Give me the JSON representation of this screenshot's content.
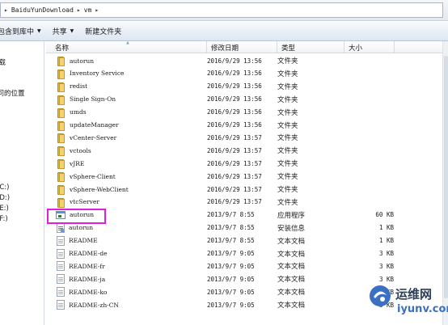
{
  "address": {
    "path": [
      "BaiduYunDownload",
      "vm"
    ],
    "separators": [
      "▸",
      "▸",
      "▸"
    ]
  },
  "toolbar": {
    "include_label": "包含到库中",
    "share_label": "共享",
    "new_folder_label": "新建文件夹"
  },
  "nav": {
    "items": [
      "下载",
      "访问的位置",
      "(C:)",
      "(D:)",
      "(E:)",
      "(F:)"
    ]
  },
  "columns": {
    "name": "名称",
    "date": "修改日期",
    "type": "类型",
    "size": "大小"
  },
  "files": [
    {
      "name": "autorun",
      "date": "2016/9/29 13:56",
      "type": "文件夹",
      "size": "",
      "icon": "folder-icon"
    },
    {
      "name": "Inventory Service",
      "date": "2016/9/29 13:56",
      "type": "文件夹",
      "size": "",
      "icon": "folder-icon"
    },
    {
      "name": "redist",
      "date": "2016/9/29 13:56",
      "type": "文件夹",
      "size": "",
      "icon": "folder-icon"
    },
    {
      "name": "Single Sign-On",
      "date": "2016/9/29 13:56",
      "type": "文件夹",
      "size": "",
      "icon": "folder-icon"
    },
    {
      "name": "umds",
      "date": "2016/9/29 13:56",
      "type": "文件夹",
      "size": "",
      "icon": "folder-icon"
    },
    {
      "name": "updateManager",
      "date": "2016/9/29 13:56",
      "type": "文件夹",
      "size": "",
      "icon": "folder-icon"
    },
    {
      "name": "vCenter-Server",
      "date": "2016/9/29 13:57",
      "type": "文件夹",
      "size": "",
      "icon": "folder-icon"
    },
    {
      "name": "vctools",
      "date": "2016/9/29 13:57",
      "type": "文件夹",
      "size": "",
      "icon": "folder-icon"
    },
    {
      "name": "vJRE",
      "date": "2016/9/29 13:57",
      "type": "文件夹",
      "size": "",
      "icon": "folder-icon"
    },
    {
      "name": "vSphere-Client",
      "date": "2016/9/29 13:57",
      "type": "文件夹",
      "size": "",
      "icon": "folder-icon"
    },
    {
      "name": "vSphere-WebClient",
      "date": "2016/9/29 13:57",
      "type": "文件夹",
      "size": "",
      "icon": "folder-icon"
    },
    {
      "name": "vtcServer",
      "date": "2016/9/29 13:57",
      "type": "文件夹",
      "size": "",
      "icon": "folder-icon"
    },
    {
      "name": "autorun",
      "date": "2013/9/7 8:55",
      "type": "应用程序",
      "size": "60 KB",
      "icon": "app-icon"
    },
    {
      "name": "autorun",
      "date": "2013/9/7 8:55",
      "type": "安装信息",
      "size": "1 KB",
      "icon": "inf-icon"
    },
    {
      "name": "README",
      "date": "2013/9/7 8:55",
      "type": "文本文档",
      "size": "1 KB",
      "icon": "txt-icon"
    },
    {
      "name": "README-de",
      "date": "2013/9/7 9:05",
      "type": "文本文档",
      "size": "3 KB",
      "icon": "txt-icon"
    },
    {
      "name": "README-fr",
      "date": "2013/9/7 9:05",
      "type": "文本文档",
      "size": "3 KB",
      "icon": "txt-icon"
    },
    {
      "name": "README-ja",
      "date": "2013/9/7 9:05",
      "type": "文本文档",
      "size": "3 KB",
      "icon": "txt-icon"
    },
    {
      "name": "README-ko",
      "date": "2013/9/7 9:05",
      "type": "文本文档",
      "size": "3 KB",
      "icon": "txt-icon"
    },
    {
      "name": "README-zh-CN",
      "date": "2013/9/7 9:05",
      "type": "文本文档",
      "size": "3 KB",
      "icon": "txt-icon"
    }
  ],
  "watermark": {
    "text": "运维网",
    "url": "iyunv.com"
  },
  "colors": {
    "highlight": "#e01ee0",
    "folder": "#e0b640"
  }
}
